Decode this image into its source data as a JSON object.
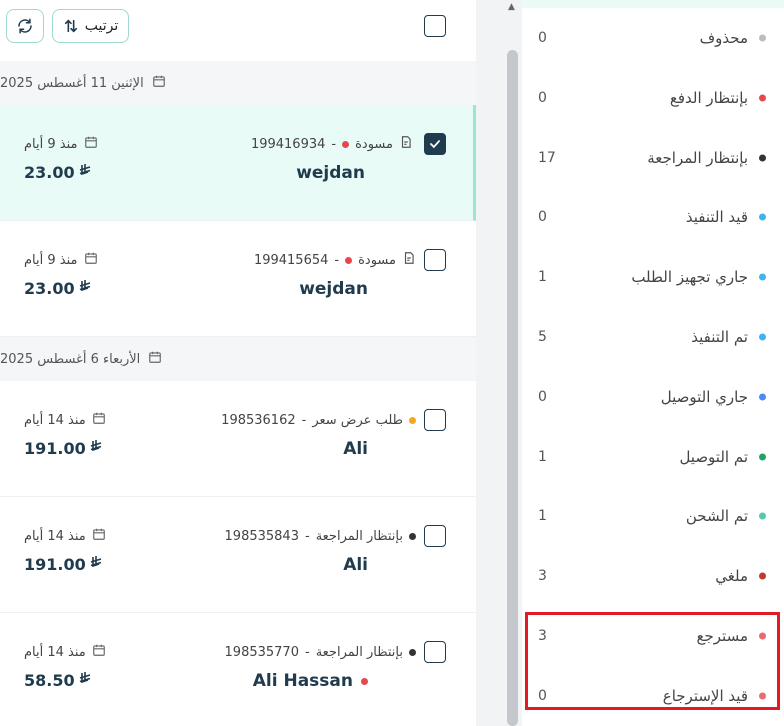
{
  "toolbar": {
    "sort_label": "ترتيب",
    "refresh_icon": "refresh-icon",
    "sort_icon": "sort-arrows-icon"
  },
  "currency_symbol": "⃁",
  "groups": [
    {
      "date": "الإثنين 11 أغسطس 2025",
      "orders": [
        {
          "status": "مسودة",
          "number": "199416934",
          "status_color": "#e5484d",
          "customer": "wejdan",
          "customer_dot": "",
          "age": "منذ 9 أيام",
          "amount": "23.00",
          "checked": true,
          "draft": true
        },
        {
          "status": "مسودة",
          "number": "199415654",
          "status_color": "#e5484d",
          "customer": "wejdan",
          "customer_dot": "",
          "age": "منذ 9 أيام",
          "amount": "23.00",
          "checked": false,
          "draft": true
        }
      ]
    },
    {
      "date": "الأربعاء 6 أغسطس 2025",
      "orders": [
        {
          "status": "طلب عرض سعر",
          "number": "198536162",
          "status_color": "#f5a623",
          "customer": "Ali",
          "customer_dot": "",
          "age": "منذ 14 أيام",
          "amount": "191.00",
          "checked": false,
          "draft": false
        },
        {
          "status": "بإنتظار المراجعة",
          "number": "198535843",
          "status_color": "#333333",
          "customer": "Ali",
          "customer_dot": "",
          "age": "منذ 14 أيام",
          "amount": "191.00",
          "checked": false,
          "draft": false
        },
        {
          "status": "بإنتظار المراجعة",
          "number": "198535770",
          "status_color": "#333333",
          "customer": "Ali Hassan",
          "customer_dot": "#e5484d",
          "age": "منذ 14 أيام",
          "amount": "58.50",
          "checked": false,
          "draft": false
        }
      ]
    }
  ],
  "statuses": [
    {
      "label": "محذوف",
      "count": "0",
      "color": "#bdbdbd"
    },
    {
      "label": "بإنتظار الدفع",
      "count": "0",
      "color": "#e5484d"
    },
    {
      "label": "بإنتظار المراجعة",
      "count": "17",
      "color": "#333333"
    },
    {
      "label": "قيد التنفيذ",
      "count": "0",
      "color": "#3bb4f2"
    },
    {
      "label": "جاري تجهيز الطلب",
      "count": "1",
      "color": "#3bb4f2"
    },
    {
      "label": "تم التنفيذ",
      "count": "5",
      "color": "#3bb4f2"
    },
    {
      "label": "جاري التوصيل",
      "count": "0",
      "color": "#4a8af4"
    },
    {
      "label": "تم التوصيل",
      "count": "1",
      "color": "#21a366"
    },
    {
      "label": "تم الشحن",
      "count": "1",
      "color": "#4fc9b0"
    },
    {
      "label": "ملغي",
      "count": "3",
      "color": "#c0392b"
    },
    {
      "label": "مسترجع",
      "count": "3",
      "color": "#e86a72"
    },
    {
      "label": "قيد الإسترجاع",
      "count": "0",
      "color": "#e86a72"
    }
  ],
  "colors": {
    "accent": "#1f3b4d",
    "selected_row": "#e9fbf7",
    "highlight_border": "#e01b24"
  }
}
